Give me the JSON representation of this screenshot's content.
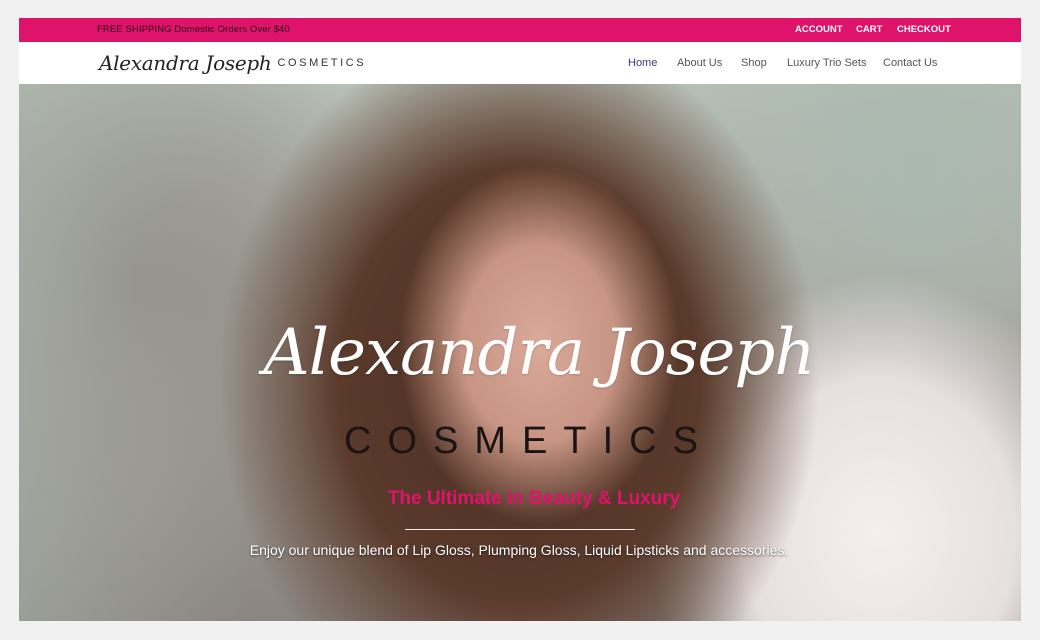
{
  "topbar": {
    "promo": "FREE SHIPPING Domestic Orders Over $40",
    "links": [
      "ACCOUNT",
      "CART",
      "CHECKOUT"
    ],
    "bg_color": "#e0136a"
  },
  "logo": {
    "script": "Alexandra Joseph",
    "caps": "COSMETICS"
  },
  "nav": {
    "items": [
      "Home",
      "About Us",
      "Shop",
      "Luxury Trio Sets",
      "Contact Us"
    ],
    "active": "Home"
  },
  "hero": {
    "script": "Alexandra Joseph",
    "caps": "COSMETICS",
    "tagline": "The Ultimate in Beauty & Luxury",
    "subtitle": "Enjoy our unique blend of Lip Gloss, Plumping Gloss, Liquid Lipsticks and accessories.",
    "tagline_color": "#e0136a"
  }
}
